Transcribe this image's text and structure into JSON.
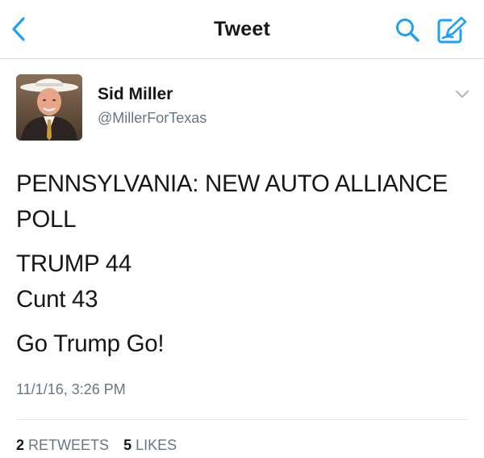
{
  "nav": {
    "title": "Tweet",
    "back_icon": "chevron-left-icon",
    "search_icon": "search-icon",
    "compose_icon": "compose-tweet-icon",
    "accent_color": "#1da1f2"
  },
  "tweet": {
    "author_name": "Sid Miller",
    "author_handle": "@MillerForTexas",
    "text_lines": [
      "PENNSYLVANIA: NEW AUTO ALLIANCE",
      "POLL",
      "TRUMP 44",
      "Cunt 43",
      "Go Trump Go!"
    ],
    "timestamp": "11/1/16, 3:26 PM",
    "retweet_count": "2",
    "retweet_label": "RETWEETS",
    "like_count": "5",
    "like_label": "LIKES"
  }
}
